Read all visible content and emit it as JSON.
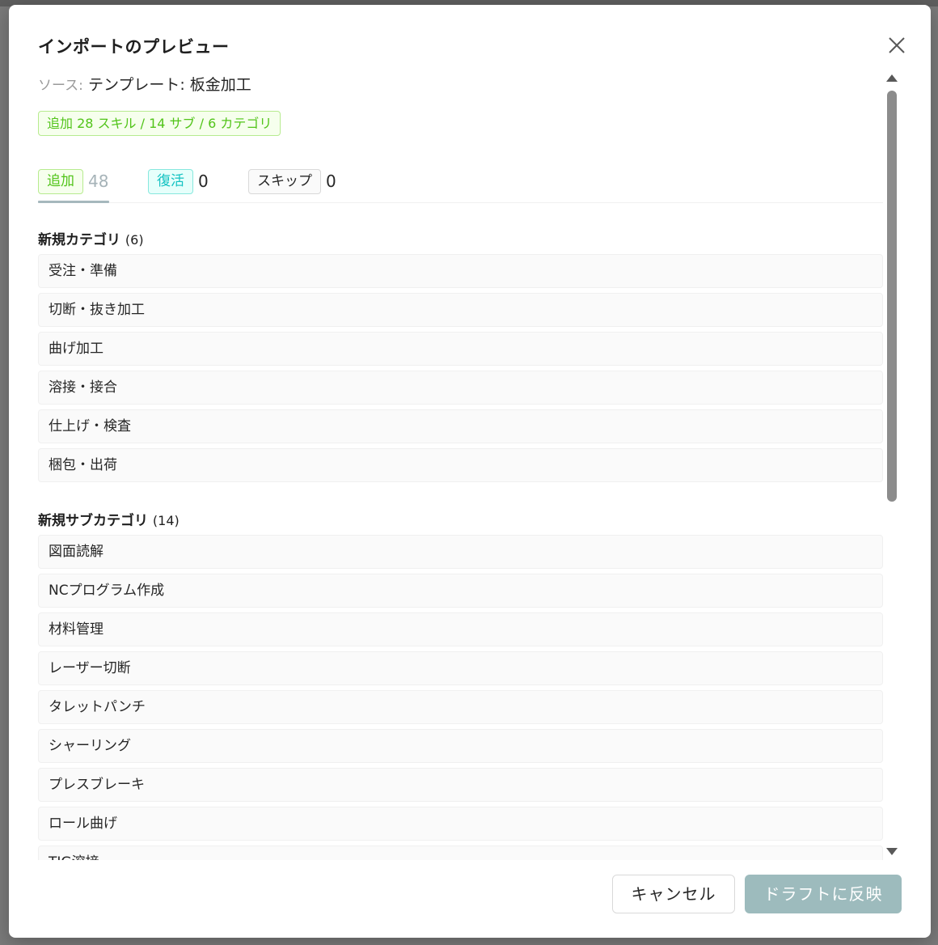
{
  "modal": {
    "title": "インポートのプレビュー",
    "source_label": "ソース:",
    "source_value": "テンプレート: 板金加工",
    "summary": "追加 28 スキル / 14 サブ / 6 カテゴリ"
  },
  "tabs": [
    {
      "label": "追加",
      "count": "48",
      "active": true
    },
    {
      "label": "復活",
      "count": "0",
      "active": false
    },
    {
      "label": "スキップ",
      "count": "0",
      "active": false
    }
  ],
  "sections": {
    "categories": {
      "title": "新規カテゴリ",
      "count": "(6)",
      "items": [
        "受注・準備",
        "切断・抜き加工",
        "曲げ加工",
        "溶接・接合",
        "仕上げ・検査",
        "梱包・出荷"
      ]
    },
    "subcategories": {
      "title": "新規サブカテゴリ",
      "count": "(14)",
      "items": [
        "図面読解",
        "NCプログラム作成",
        "材料管理",
        "レーザー切断",
        "タレットパンチ",
        "シャーリング",
        "プレスブレーキ",
        "ロール曲げ",
        "TIG溶接"
      ]
    }
  },
  "footer": {
    "cancel_label": "キャンセル",
    "apply_label": "ドラフトに反映"
  },
  "icons": {
    "close": "close-icon",
    "scroll_up": "scroll-up-arrow-icon",
    "scroll_down": "scroll-down-arrow-icon"
  },
  "colors": {
    "add_tag": "#52c41a",
    "revive_tag": "#13c2c2",
    "apply_button": "#9dbbbd"
  }
}
